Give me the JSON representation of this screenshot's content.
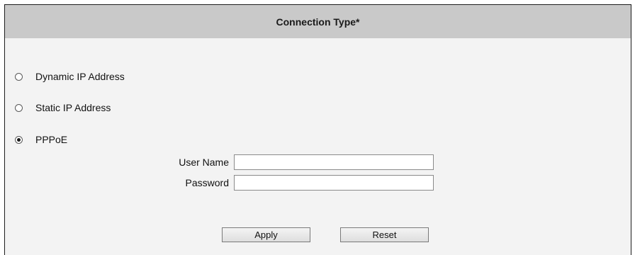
{
  "header": {
    "title": "Connection Type*"
  },
  "connection_options": [
    {
      "label": "Dynamic IP Address",
      "selected": false
    },
    {
      "label": "Static IP Address",
      "selected": false
    },
    {
      "label": "PPPoE",
      "selected": true
    }
  ],
  "pppoe": {
    "username_label": "User Name",
    "username_value": "",
    "password_label": "Password",
    "password_value": ""
  },
  "buttons": {
    "apply_label": "Apply",
    "reset_label": "Reset"
  }
}
